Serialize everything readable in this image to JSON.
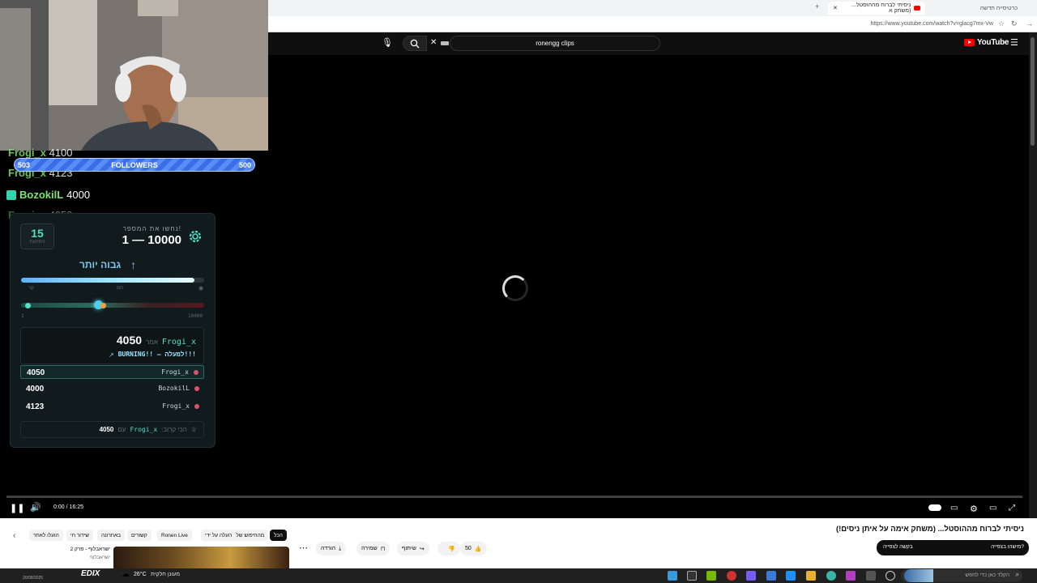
{
  "browser": {
    "tabs": [
      {
        "label": "ניסיתי לברוח מההוסטל... (משחק א"
      },
      {
        "label": "כרטיסייה חדשה"
      }
    ],
    "url": "https://www.youtube.com/watch?v=glacg7mx-Vw"
  },
  "youtube": {
    "search_value": "ronengg clips",
    "logo": "YouTube",
    "video_title": "ניסיתי לברוח מההוסטל... (משחק אימה על איתן ניסים!)",
    "time": "0:00 / 16:25",
    "like_count": "50",
    "actions": {
      "share": "שיתוף",
      "save": "שמירה",
      "download": "הורדה"
    },
    "chips": [
      {
        "label": "הכל"
      },
      {
        "label": "מהחיפוש שלך"
      },
      {
        "label": "העלה על ידי"
      },
      {
        "label": "Ronen Live"
      },
      {
        "label": "קשורים"
      },
      {
        "label": "באחרונה"
      },
      {
        "label": "שידור חי"
      },
      {
        "label": "הועלו לאחר"
      }
    ],
    "sidebar_video": {
      "title": "ישראבלוף - פרק 2",
      "channel": "ישראבלוף"
    },
    "toast_primary": "מישהו בצפייה?",
    "toast_secondary": "בקשה לצפייה"
  },
  "overlay": {
    "chat": [
      {
        "user": "Frogi_x",
        "value": "4100"
      },
      {
        "user": "Frogi_x",
        "value": "4123"
      },
      {
        "user": "BozokilL",
        "value": "4000"
      },
      {
        "user": "Frogi_x",
        "value": "4050"
      }
    ],
    "followers": {
      "label": "FOLLOWERS",
      "current": "503",
      "goal": "500"
    },
    "game": {
      "tries": "15",
      "tries_label": "ניסיונות",
      "prompt": "נחשו את המספר!",
      "range": "1 — 10000",
      "hint": "גבוה יותר",
      "temperature_labels": {
        "cold": "קר",
        "hot": "חם"
      },
      "range_min": "1",
      "range_max": "10000",
      "slider_level": 0.42,
      "last_guess": {
        "user": "Frogi_x",
        "said": "אמר",
        "value": "4050",
        "status": "BURNING!! — למעלה!!!"
      },
      "leaderboard": [
        {
          "user": "Frogi_x",
          "value": "4050"
        },
        {
          "user": "BozokilL",
          "value": "4000"
        },
        {
          "user": "Frogi_x",
          "value": "4123"
        }
      ],
      "closest": {
        "label": "הכי קרוב:",
        "user": "Frogi_x",
        "with": "עם",
        "value": "4050"
      }
    }
  },
  "taskbar": {
    "weather_temp": "26°C",
    "weather_desc": "מעונן חלקית",
    "search_placeholder": "הקלד כאן כדי לחפש",
    "brand": "EDIX",
    "time": "20/08/2025"
  }
}
